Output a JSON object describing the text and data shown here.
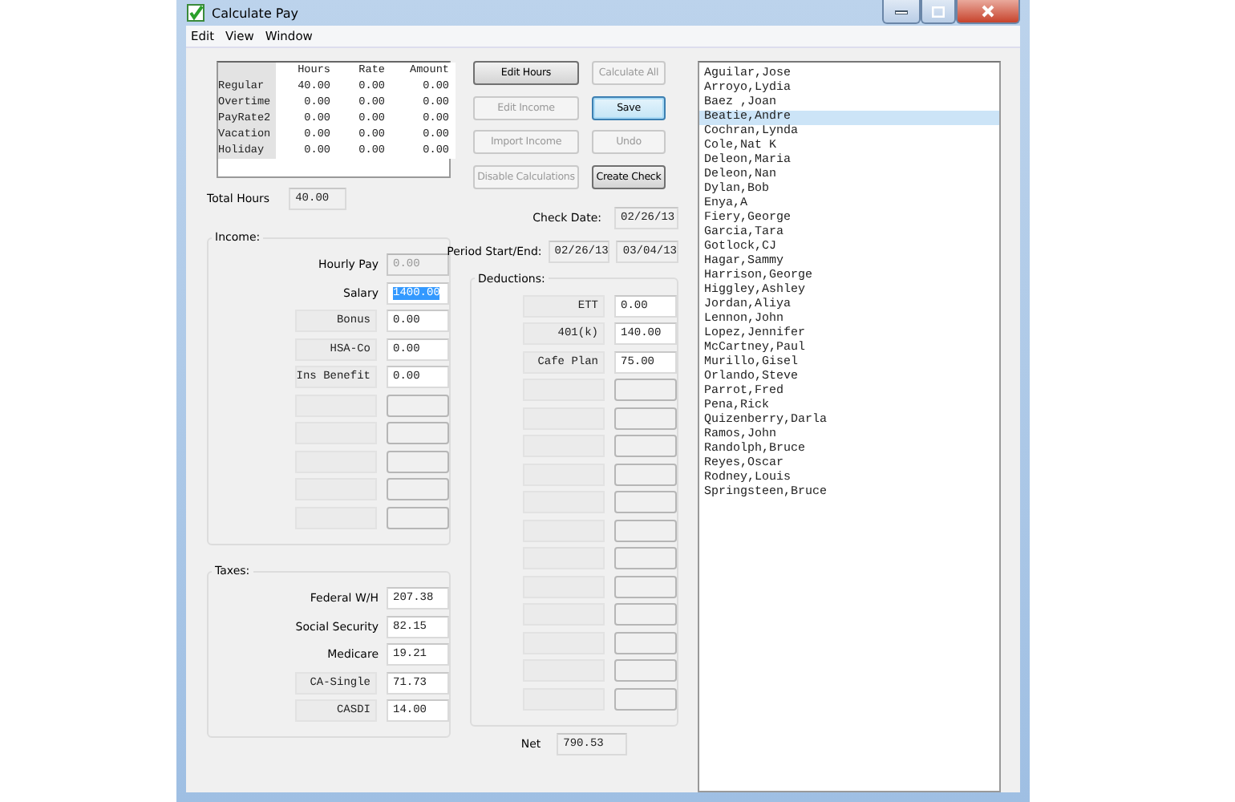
{
  "window": {
    "title": "Calculate Pay"
  },
  "menu": [
    {
      "label": "Edit"
    },
    {
      "label": "View"
    },
    {
      "label": "Window"
    }
  ],
  "hours_table": {
    "columns": [
      "Hours",
      "Rate",
      "Amount"
    ],
    "rows": [
      {
        "label": "Regular",
        "values": [
          "40.00",
          "0.00",
          "0.00"
        ]
      },
      {
        "label": "Overtime",
        "values": [
          "0.00",
          "0.00",
          "0.00"
        ]
      },
      {
        "label": "PayRate2",
        "values": [
          "0.00",
          "0.00",
          "0.00"
        ]
      },
      {
        "label": "Vacation",
        "values": [
          "0.00",
          "0.00",
          "0.00"
        ]
      },
      {
        "label": "Holiday",
        "values": [
          "0.00",
          "0.00",
          "0.00"
        ]
      }
    ]
  },
  "total_hours": {
    "label": "Total Hours",
    "value": "40.00"
  },
  "buttons": [
    {
      "label": "Edit Hours",
      "disabled": false,
      "focused": false
    },
    {
      "label": "Calculate All",
      "disabled": true,
      "focused": false
    },
    {
      "label": "Edit Income",
      "disabled": true,
      "focused": false
    },
    {
      "label": "Save",
      "disabled": false,
      "focused": true
    },
    {
      "label": "Import Income",
      "disabled": true,
      "focused": false
    },
    {
      "label": "Undo",
      "disabled": true,
      "focused": false
    },
    {
      "label": "Disable Calculations",
      "disabled": true,
      "focused": false
    },
    {
      "label": "Create Check",
      "disabled": false,
      "focused": false
    }
  ],
  "check_date": {
    "label": "Check Date:",
    "value": "02/26/13"
  },
  "period": {
    "label": "Period Start/End:",
    "start": "02/26/13",
    "end": "03/04/13"
  },
  "income": {
    "title": "Income:",
    "fields": [
      {
        "kind": "plain",
        "label": "Hourly Pay",
        "value": "0.00",
        "disabled": true,
        "selected": false
      },
      {
        "kind": "plain",
        "label": "Salary",
        "value": "1400.00",
        "disabled": false,
        "selected": true
      },
      {
        "kind": "boxed",
        "label": "Bonus",
        "value": "0.00",
        "disabled": false,
        "selected": false
      },
      {
        "kind": "boxed",
        "label": "HSA-Co",
        "value": "0.00",
        "disabled": false,
        "selected": false
      },
      {
        "kind": "boxed",
        "label": "Ins Benefit",
        "value": "0.00",
        "disabled": false,
        "selected": false
      },
      {
        "kind": "empty"
      },
      {
        "kind": "empty"
      },
      {
        "kind": "empty"
      },
      {
        "kind": "empty"
      },
      {
        "kind": "empty"
      }
    ]
  },
  "taxes": {
    "title": "Taxes:",
    "fields": [
      {
        "kind": "plain",
        "label": "Federal W/H",
        "value": "207.38",
        "disabled": false,
        "selected": false
      },
      {
        "kind": "plain",
        "label": "Social Security",
        "value": "82.15",
        "disabled": false,
        "selected": false
      },
      {
        "kind": "plain",
        "label": "Medicare",
        "value": "19.21",
        "disabled": false,
        "selected": false
      },
      {
        "kind": "boxed",
        "label": "CA-Single",
        "value": "71.73",
        "disabled": false,
        "selected": false
      },
      {
        "kind": "boxed",
        "label": "CASDI",
        "value": "14.00",
        "disabled": false,
        "selected": false
      }
    ]
  },
  "deductions": {
    "title": "Deductions:",
    "fields": [
      {
        "kind": "boxed",
        "label": "ETT",
        "value": "0.00",
        "disabled": false,
        "selected": false
      },
      {
        "kind": "boxed",
        "label": "401(k)",
        "value": "140.00",
        "disabled": false,
        "selected": false
      },
      {
        "kind": "boxed",
        "label": "Cafe Plan",
        "value": "75.00",
        "disabled": false,
        "selected": false
      },
      {
        "kind": "empty"
      },
      {
        "kind": "empty"
      },
      {
        "kind": "empty"
      },
      {
        "kind": "empty"
      },
      {
        "kind": "empty"
      },
      {
        "kind": "empty"
      },
      {
        "kind": "empty"
      },
      {
        "kind": "empty"
      },
      {
        "kind": "empty"
      },
      {
        "kind": "empty"
      },
      {
        "kind": "empty"
      },
      {
        "kind": "empty"
      }
    ]
  },
  "net": {
    "label": "Net",
    "value": "790.53"
  },
  "employees": [
    {
      "name": "Aguilar,Jose",
      "selected": false
    },
    {
      "name": "Arroyo,Lydia",
      "selected": false
    },
    {
      "name": "Baez ,Joan",
      "selected": false
    },
    {
      "name": "Beatie,Andre",
      "selected": true
    },
    {
      "name": "Cochran,Lynda",
      "selected": false
    },
    {
      "name": "Cole,Nat K",
      "selected": false
    },
    {
      "name": "Deleon,Maria",
      "selected": false
    },
    {
      "name": "Deleon,Nan",
      "selected": false
    },
    {
      "name": "Dylan,Bob",
      "selected": false
    },
    {
      "name": "Enya,A",
      "selected": false
    },
    {
      "name": "Fiery,George",
      "selected": false
    },
    {
      "name": "Garcia,Tara",
      "selected": false
    },
    {
      "name": "Gotlock,CJ",
      "selected": false
    },
    {
      "name": "Hagar,Sammy",
      "selected": false
    },
    {
      "name": "Harrison,George",
      "selected": false
    },
    {
      "name": "Higgley,Ashley",
      "selected": false
    },
    {
      "name": "Jordan,Aliya",
      "selected": false
    },
    {
      "name": "Lennon,John",
      "selected": false
    },
    {
      "name": "Lopez,Jennifer",
      "selected": false
    },
    {
      "name": "McCartney,Paul",
      "selected": false
    },
    {
      "name": "Murillo,Gisel",
      "selected": false
    },
    {
      "name": "Orlando,Steve",
      "selected": false
    },
    {
      "name": "Parrot,Fred",
      "selected": false
    },
    {
      "name": "Pena,Rick",
      "selected": false
    },
    {
      "name": "Quizenberry,Darla",
      "selected": false
    },
    {
      "name": "Ramos,John",
      "selected": false
    },
    {
      "name": "Randolph,Bruce",
      "selected": false
    },
    {
      "name": "Reyes,Oscar",
      "selected": false
    },
    {
      "name": "Rodney,Louis",
      "selected": false
    },
    {
      "name": "Springsteen,Bruce",
      "selected": false
    }
  ]
}
